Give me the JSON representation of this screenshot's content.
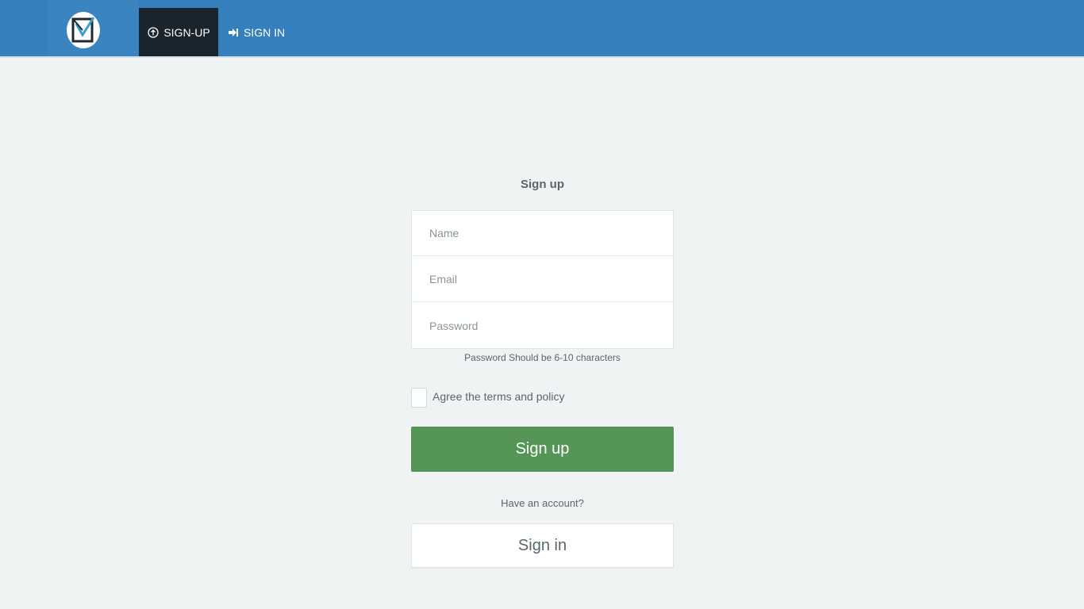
{
  "nav": {
    "signup_label": "SIGN-UP",
    "signin_label": "SIGN IN"
  },
  "form": {
    "title": "Sign up",
    "name_placeholder": "Name",
    "email_placeholder": "Email",
    "password_placeholder": "Password",
    "password_hint": "Password Should be 6-10 characters",
    "agree_label": "Agree the terms and policy",
    "signup_button": "Sign up",
    "have_account": "Have an account?",
    "signin_button": "Sign in"
  },
  "colors": {
    "topbar": "#3580bc",
    "active_nav": "#1a242c",
    "primary_button": "#559556",
    "background": "#f0f3f4"
  },
  "icons": {
    "logo": "logo-icon",
    "signup": "arrow-up-circle-icon",
    "signin": "sign-in-icon"
  }
}
